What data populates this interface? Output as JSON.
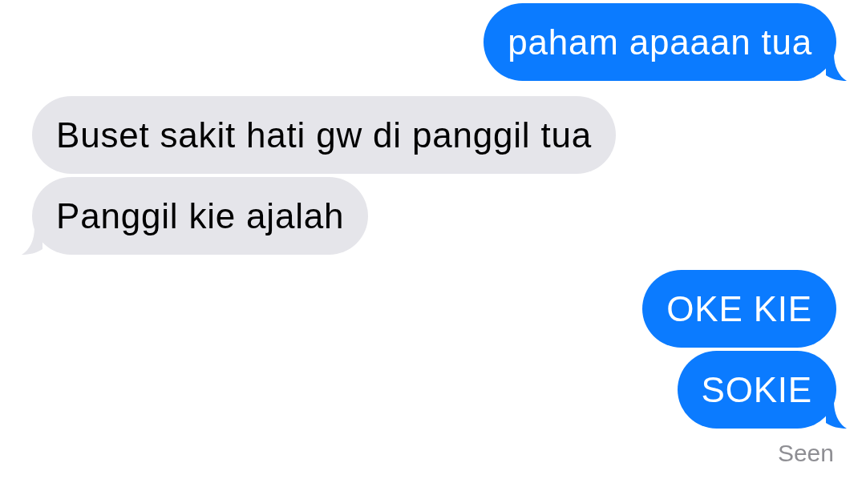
{
  "messages": [
    {
      "kind": "outgoing",
      "text": "paham apaaan tua",
      "tail": true
    },
    {
      "kind": "incoming",
      "text": "Buset sakit hati gw di panggil tua",
      "tail": false
    },
    {
      "kind": "incoming",
      "text": "Panggil kie ajalah",
      "tail": true
    },
    {
      "kind": "outgoing",
      "text": "OKE KIE",
      "tail": false
    },
    {
      "kind": "outgoing",
      "text": "SOKIE",
      "tail": true
    }
  ],
  "status": "Seen"
}
